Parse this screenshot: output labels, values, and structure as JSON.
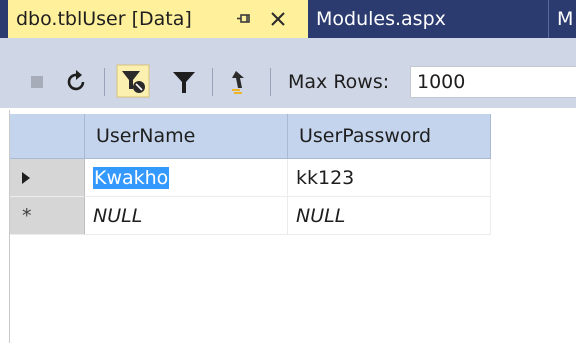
{
  "tabs": [
    {
      "label": "dbo.tblUser [Data]",
      "active": true
    },
    {
      "label": "Modules.aspx",
      "active": false
    },
    {
      "label": "M",
      "active": false
    }
  ],
  "icons": {
    "pin": "pin-icon",
    "close": "close-icon",
    "stop": "stop-icon",
    "refresh": "refresh-icon",
    "filter_toggle": "filter-pane-icon",
    "filter": "filter-icon",
    "plan": "execute-icon"
  },
  "toolbar": {
    "max_rows_label": "Max Rows:",
    "max_rows_value": "1000"
  },
  "grid": {
    "columns": [
      "UserName",
      "UserPassword"
    ],
    "rows": [
      {
        "indicator": "current",
        "values": [
          "Kwakho",
          "kk123"
        ]
      },
      {
        "indicator": "new",
        "marker": "*",
        "values": [
          "NULL",
          "NULL"
        ]
      }
    ]
  },
  "colors": {
    "tab_bar": "#2b3b70",
    "active_tab": "#fff09b",
    "toolbar": "#cfd6e5",
    "header": "#c4d4ed",
    "selection": "#3399ff"
  }
}
